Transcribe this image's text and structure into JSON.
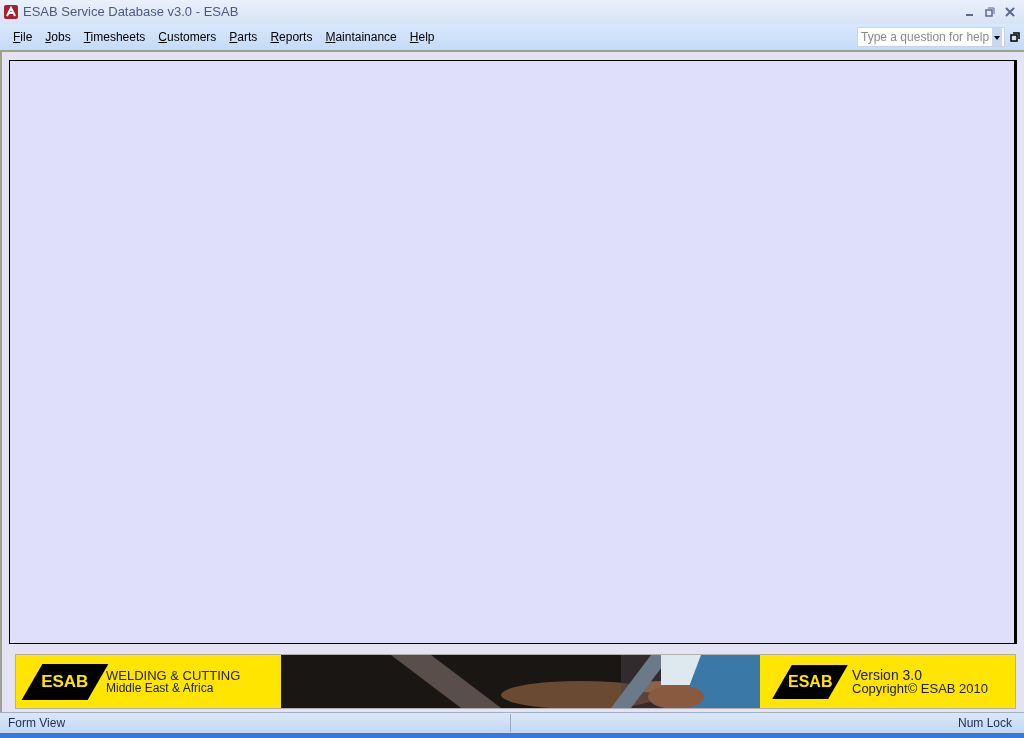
{
  "window": {
    "title": "ESAB Service Database v3.0 - ESAB"
  },
  "menu": [
    {
      "label": "File"
    },
    {
      "label": "Jobs"
    },
    {
      "label": "Timesheets"
    },
    {
      "label": "Customers"
    },
    {
      "label": "Parts"
    },
    {
      "label": "Reports"
    },
    {
      "label": "Maintainance"
    },
    {
      "label": "Help"
    }
  ],
  "help_search": {
    "placeholder": "Type a question for help"
  },
  "banner": {
    "left_logo": "ESAB",
    "left_title": "WELDING & CUTTING",
    "left_subtitle": "Middle East & Africa",
    "right_logo": "ESAB",
    "version": "Version 3.0",
    "copyright": "Copyright© ESAB 2010"
  },
  "status_bar": {
    "mode": "Form View",
    "indicator": "Num Lock"
  }
}
